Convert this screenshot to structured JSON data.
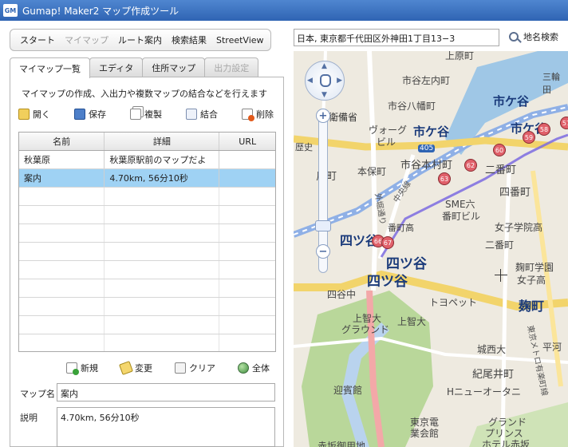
{
  "app": {
    "title": "Gumap! Maker2 マップ作成ツール",
    "logo_text": "GM"
  },
  "nav_tabs": [
    {
      "label": "スタート",
      "enabled": true
    },
    {
      "label": "マイマップ",
      "enabled": false
    },
    {
      "label": "ルート案内",
      "enabled": true
    },
    {
      "label": "検索結果",
      "enabled": true
    },
    {
      "label": "StreetView",
      "enabled": true
    }
  ],
  "panel_tabs": [
    {
      "label": "マイマップ一覧",
      "active": true
    },
    {
      "label": "エディタ",
      "active": false
    },
    {
      "label": "住所マップ",
      "active": false
    },
    {
      "label": "出力設定",
      "disabled": true
    }
  ],
  "mymap": {
    "description": "マイマップの作成、入出力や複数マップの結合などを行えます",
    "toolbar": [
      {
        "label": "開く",
        "icon": "folder-open-icon"
      },
      {
        "label": "保存",
        "icon": "save-icon"
      },
      {
        "label": "複製",
        "icon": "copy-icon"
      },
      {
        "label": "結合",
        "icon": "merge-icon"
      },
      {
        "label": "削除",
        "icon": "delete-icon"
      }
    ],
    "table": {
      "columns": [
        "名前",
        "詳細",
        "URL"
      ],
      "rows": [
        {
          "name": "秋葉原",
          "detail": "秋葉原駅前のマップだよ",
          "url": "",
          "selected": false
        },
        {
          "name": "案内",
          "detail": "4.70km, 56分10秒",
          "url": "",
          "selected": true
        }
      ]
    },
    "toolbar2": [
      {
        "label": "新規",
        "icon": "new-icon"
      },
      {
        "label": "変更",
        "icon": "edit-icon"
      },
      {
        "label": "クリア",
        "icon": "clear-icon"
      },
      {
        "label": "全体",
        "icon": "globe-icon"
      }
    ],
    "map_name_label": "マップ名",
    "map_name_value": "案内",
    "description_label": "説明",
    "description_value": "4.70km, 56分10秒"
  },
  "search": {
    "address_value": "日本, 東京都千代田区外神田1丁目13−3",
    "button_label": "地名検索"
  },
  "map": {
    "labels": [
      "上原町",
      "市谷左内町",
      "三輪田",
      "市谷八幡町",
      "市ケ谷",
      "市ケ谷",
      "市ケ谷",
      "衛備省",
      "ヴォーグ",
      "ビル",
      "405",
      "歴史",
      "本保町",
      "市谷本村町",
      "二番町",
      "四番町",
      "反町",
      "中央線",
      "外堀通り",
      "SME六",
      "番町ビル",
      "女子学院高",
      "番町高",
      "二番町",
      "麹町学園",
      "女子高",
      "四ツ谷",
      "四ツ谷",
      "四ツ谷",
      "四谷中",
      "トヨペット",
      "麹町",
      "上智大",
      "グラウンド",
      "上智大",
      "東京メトロ有楽町線",
      "平河",
      "城西大",
      "紀尾井町",
      "迎賓館",
      "Hニューオータニ",
      "東京電",
      "業会館",
      "グランド",
      "プリンス",
      "ホテル赤坂",
      "赤坂御用地"
    ],
    "markers": [
      "57",
      "58",
      "59",
      "60",
      "62",
      "63",
      "66",
      "67"
    ],
    "route_color": "#7b6be0",
    "marker_color": "#e0606a",
    "rail_color": "#8fb0e6"
  }
}
